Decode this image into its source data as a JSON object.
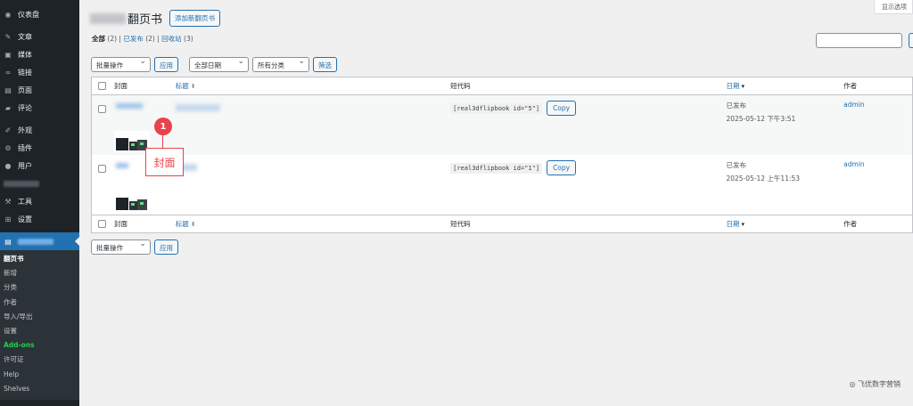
{
  "sidebar": {
    "items": [
      {
        "icon": "dashboard-icon",
        "glyph": "◉",
        "label": "仪表盘"
      },
      {
        "icon": "pin-icon",
        "glyph": "✎",
        "label": "文章"
      },
      {
        "icon": "media-icon",
        "glyph": "▣",
        "label": "媒体"
      },
      {
        "icon": "link-icon",
        "glyph": "∞",
        "label": "链接"
      },
      {
        "icon": "page-icon",
        "glyph": "▤",
        "label": "页面"
      },
      {
        "icon": "comment-icon",
        "glyph": "▰",
        "label": "评论"
      },
      {
        "icon": "appearance-icon",
        "glyph": "✐",
        "label": "外观"
      },
      {
        "icon": "plugin-icon",
        "glyph": "⚙",
        "label": "插件"
      },
      {
        "icon": "user-icon",
        "glyph": "●",
        "label": "用户"
      },
      {
        "icon": "tools-icon",
        "glyph": "⚒",
        "label": "工具"
      },
      {
        "icon": "settings-icon",
        "glyph": "⊞",
        "label": "设置"
      }
    ],
    "submenu": [
      "翻页书",
      "新增",
      "分类",
      "作者",
      "导入/导出",
      "设置",
      "Add-ons",
      "许可证",
      "Help",
      "Shelves"
    ]
  },
  "header": {
    "screen_options": "显示选项",
    "title": "翻页书",
    "add_new": "添加新翻页书"
  },
  "views": {
    "all": "全部",
    "all_count": "(2)",
    "published": "已发布",
    "published_count": "(2)",
    "trash": "回收站",
    "trash_count": "(3)"
  },
  "filters": {
    "bulk_action": "批量操作",
    "apply": "应用",
    "all_dates": "全部日期",
    "all_categories": "所有分类",
    "filter": "筛选"
  },
  "table": {
    "columns": {
      "cover": "封面",
      "title": "标题",
      "shortcode": "短代码",
      "date": "日期",
      "author": "作者"
    },
    "rows": [
      {
        "shortcode": "[real3dflipbook id=\"5\"]",
        "copy": "Copy",
        "status": "已发布",
        "datetime": "2025-05-12 下午3:51",
        "author": "admin"
      },
      {
        "shortcode": "[real3dflipbook id=\"1\"]",
        "copy": "Copy",
        "status": "已发布",
        "datetime": "2025-05-12 上午11:53",
        "author": "admin"
      }
    ]
  },
  "annotation": {
    "number": "1",
    "label": "封面"
  },
  "watermark": "◎ 飞优数字营销"
}
